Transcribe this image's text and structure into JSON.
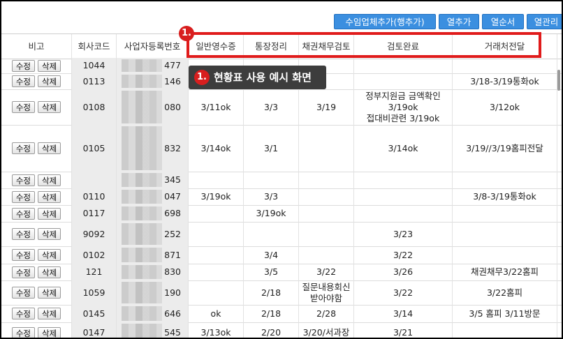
{
  "toolbar": {
    "buttons": [
      "수임업체추가(행추가)",
      "열추가",
      "열순서",
      "열관리"
    ]
  },
  "annotation": {
    "badge": "1.",
    "callout": "현황표 사용 예시 화면",
    "box_color": "#e01b1b"
  },
  "colors": {
    "accent": "#3b8fe0",
    "highlight": "#e01b1b",
    "callout_bg": "#3d3d3d"
  },
  "table": {
    "headers": [
      "비고",
      "회사코드",
      "사업자등록번호",
      "일반영수증",
      "통장정리",
      "채권채무검토",
      "검토완료",
      "거래처전달"
    ],
    "edit_label": "수정",
    "delete_label": "삭제",
    "rows": [
      {
        "code": "1044",
        "biz": "477",
        "receipt": "",
        "bank": "",
        "debt": "",
        "review": "",
        "deliver": ""
      },
      {
        "code": "0113",
        "biz": "146",
        "receipt": "",
        "bank": "",
        "debt": "",
        "review": "",
        "deliver": "3/18-3/19통화ok"
      },
      {
        "code": "0108",
        "biz": "080",
        "receipt": "3/11ok",
        "bank": "3/3",
        "debt": "3/19",
        "review": "정부지원금 금액확인\n3/19ok\n접대비관련 3/19ok",
        "deliver": "3/12ok"
      },
      {
        "code": "0105",
        "biz": "832",
        "receipt": "3/14ok",
        "bank": "3/1",
        "debt": "",
        "review": "3/14ok",
        "deliver": "3/19//3/19홈피전달"
      },
      {
        "code": "",
        "biz": "345",
        "receipt": "",
        "bank": "",
        "debt": "",
        "review": "",
        "deliver": ""
      },
      {
        "code": "0110",
        "biz": "047",
        "receipt": "3/19ok",
        "bank": "3/3",
        "debt": "",
        "review": "",
        "deliver": "3/8-3/19통화ok"
      },
      {
        "code": "0117",
        "biz": "698",
        "receipt": "",
        "bank": "3/19ok",
        "debt": "",
        "review": "",
        "deliver": ""
      },
      {
        "code": "9092",
        "biz": "252",
        "receipt": "",
        "bank": "",
        "debt": "",
        "review": "3/23",
        "deliver": ""
      },
      {
        "code": "0102",
        "biz": "871",
        "receipt": "",
        "bank": "3/4",
        "debt": "",
        "review": "3/22",
        "deliver": ""
      },
      {
        "code": "121",
        "biz": "830",
        "receipt": "",
        "bank": "3/5",
        "debt": "3/22",
        "review": "3/26",
        "deliver": "채권채무3/22홈피"
      },
      {
        "code": "1059",
        "biz": "190",
        "receipt": "",
        "bank": "2/18",
        "debt": "질문내용회신\n받아야함",
        "review": "3/22",
        "deliver": "3/22홈피"
      },
      {
        "code": "0145",
        "biz": "646",
        "receipt": "ok",
        "bank": "2/18",
        "debt": "2/28",
        "review": "3/14",
        "deliver": "3/5 홈피 3/11방문"
      },
      {
        "code": "0147",
        "biz": "545",
        "receipt": "3/13ok",
        "bank": "2/20",
        "debt": "3/20/서과장",
        "review": "3/21",
        "deliver": ""
      }
    ]
  }
}
